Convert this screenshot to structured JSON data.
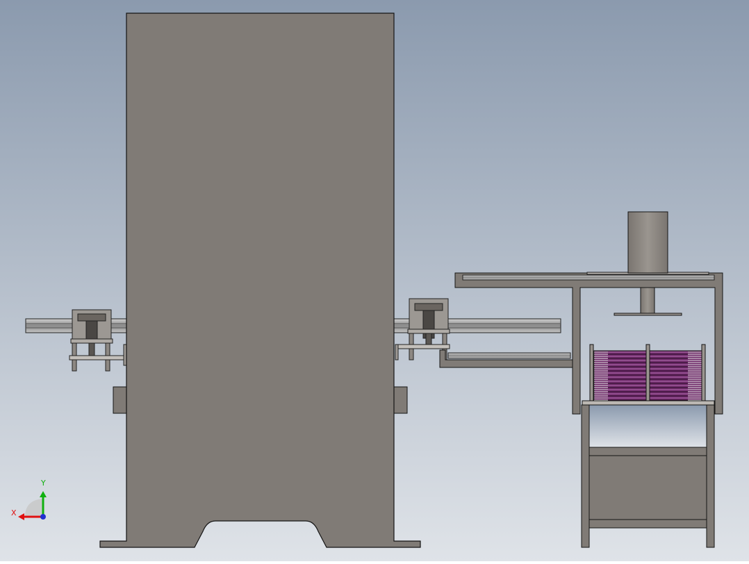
{
  "viewport": {
    "background_top": "#8b9aae",
    "background_bottom": "#dfe3e8"
  },
  "colors": {
    "part_fill": "#807b76",
    "edge": "#141414",
    "rail": "#a9a9a9",
    "stack_fill": "#6f2a6a"
  },
  "triad": {
    "x_label": "X",
    "y_label": "Y",
    "x_color": "#e01010",
    "y_color": "#10b010",
    "z_color": "#2030d0"
  }
}
